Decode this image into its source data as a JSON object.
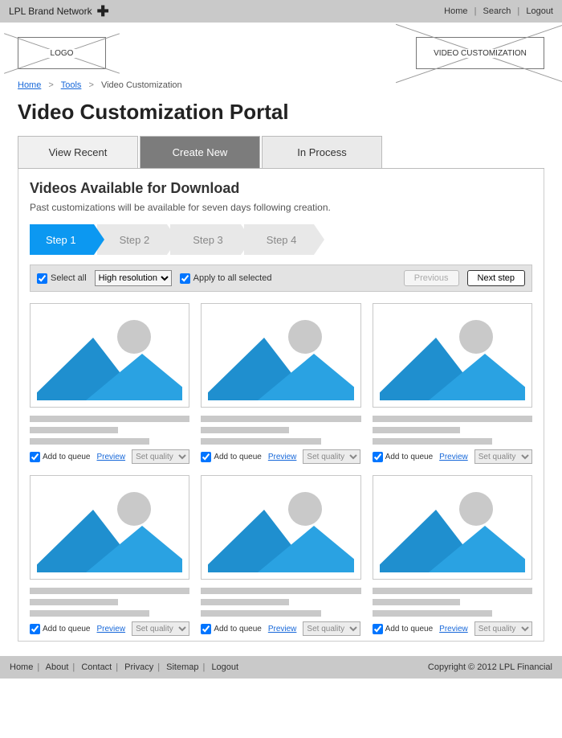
{
  "topbar": {
    "brand": "LPL Brand Network",
    "links": [
      "Home",
      "Search",
      "Logout"
    ]
  },
  "header": {
    "logo_label": "LOGO",
    "hero_label": "VIDEO CUSTOMIZATION"
  },
  "breadcrumb": {
    "items": [
      "Home",
      "Tools",
      "Video Customization"
    ]
  },
  "page_title": "Video Customization Portal",
  "tabs": [
    "View Recent",
    "Create New",
    "In Process"
  ],
  "panel": {
    "heading": "Videos Available for Download",
    "subheading": "Past customizations will be available for seven days following creation."
  },
  "steps": [
    "Step 1",
    "Step 2",
    "Step 3",
    "Step 4"
  ],
  "toolbar": {
    "select_all": "Select all",
    "resolution_selected": "High resolution",
    "apply_all": "Apply to all selected",
    "prev": "Previous",
    "next": "Next step"
  },
  "card": {
    "add_queue": "Add to queue",
    "preview": "Preview",
    "quality_placeholder": "Set quality"
  },
  "footer": {
    "links": [
      "Home",
      "About",
      "Contact",
      "Privacy",
      "Sitemap",
      "Logout"
    ],
    "copyright": "Copyright © 2012 LPL Financial"
  }
}
